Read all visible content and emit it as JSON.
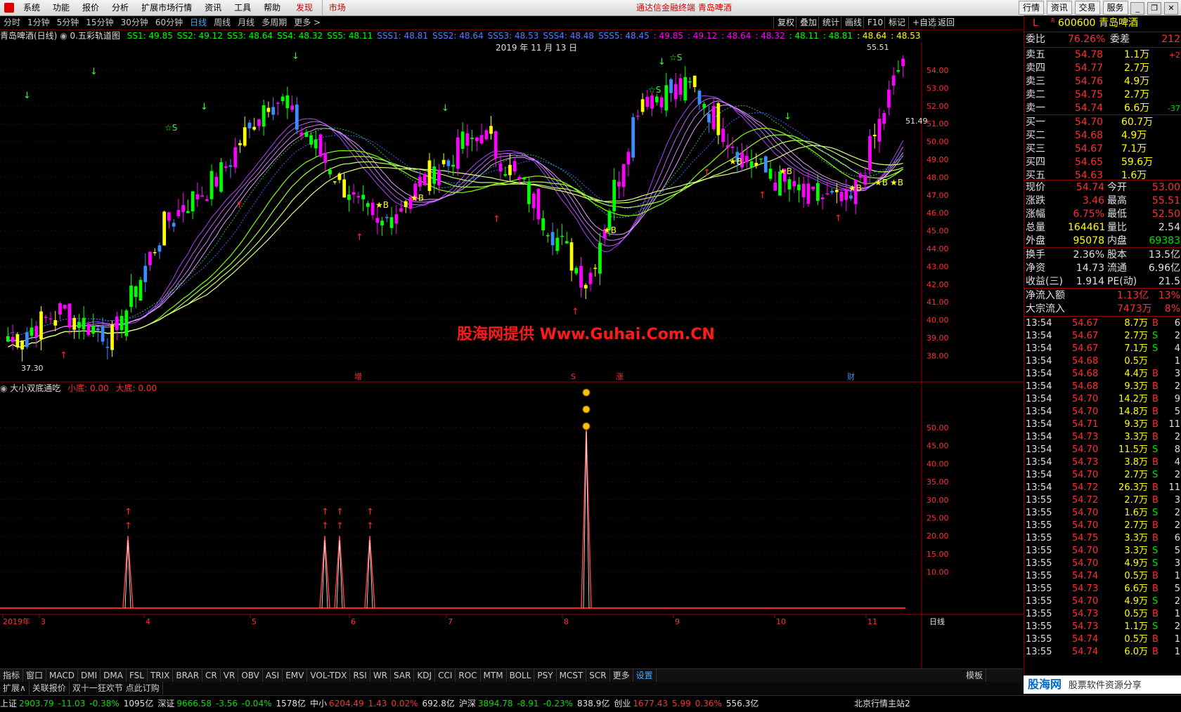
{
  "menubar": {
    "items": [
      "系统",
      "功能",
      "报价",
      "分析",
      "扩展市场行情",
      "资讯",
      "工具",
      "帮助"
    ],
    "hl1": "发现",
    "hl2": "市场",
    "title": "通达信金融终端  青岛啤酒",
    "right": [
      "行情",
      "资讯",
      "交易",
      "服务"
    ]
  },
  "periodbar": {
    "items": [
      "分时",
      "1分钟",
      "5分钟",
      "15分钟",
      "30分钟",
      "60分钟",
      "日线",
      "周线",
      "月线",
      "多周期",
      "更多 >"
    ],
    "active_index": 6,
    "right": [
      "复权",
      "叠加",
      "统计",
      "画线",
      "F10",
      "标记",
      "+自选",
      "返回"
    ]
  },
  "main_legend": {
    "title": "青岛啤酒(日线)",
    "indicator": "0.五彩轨道图",
    "items": [
      {
        "t": "SS1: 49.85",
        "c": "#00ff00"
      },
      {
        "t": "SS2: 49.12",
        "c": "#00ff00"
      },
      {
        "t": "SS3: 48.64",
        "c": "#00ff00"
      },
      {
        "t": "SS4: 48.32",
        "c": "#00ff00"
      },
      {
        "t": "SS5: 48.11",
        "c": "#00ff00"
      },
      {
        "t": "SSS1: 48.81",
        "c": "#5080ff"
      },
      {
        "t": "SSS2: 48.64",
        "c": "#5080ff"
      },
      {
        "t": "SSS3: 48.53",
        "c": "#5080ff"
      },
      {
        "t": "SSS4: 48.48",
        "c": "#5080ff"
      },
      {
        "t": "SSS5: 48.45",
        "c": "#5080ff"
      },
      {
        "t": ": 49.85",
        "c": "#ff00ff"
      },
      {
        "t": ": 49.12",
        "c": "#ff00ff"
      },
      {
        "t": ": 48.64",
        "c": "#ff00ff"
      },
      {
        "t": ": 48.32",
        "c": "#ff00ff"
      },
      {
        "t": ": 48.11",
        "c": "#00ff00"
      },
      {
        "t": ": 48.81",
        "c": "#00ff00"
      },
      {
        "t": ": 48.64",
        "c": "#ffff00"
      },
      {
        "t": ": 48.53",
        "c": "#ffff00"
      }
    ]
  },
  "chart_date": "2019 年 11 月 13 日",
  "price_axis": [
    "54.00",
    "53.00",
    "52.00",
    "51.00",
    "50.00",
    "49.00",
    "48.00",
    "47.00",
    "46.00",
    "45.00",
    "44.00",
    "43.00",
    "42.00",
    "41.00",
    "40.00",
    "39.00",
    "38.00"
  ],
  "main_labels": {
    "high": "55.51",
    "low": "37.30",
    "last": "51.49"
  },
  "event_marks": [
    {
      "t": "增"
    },
    {
      "t": "S"
    },
    {
      "t": "涨"
    },
    {
      "t": "财"
    }
  ],
  "watermark": "股海网提供 Www.Guhai.Com.CN",
  "sub_legend": {
    "title": "大小双底通吃",
    "l1": "小底: 0.00",
    "l2": "大底: 0.00"
  },
  "sub_axis": [
    "50.00",
    "45.00",
    "40.00",
    "35.00",
    "30.00",
    "25.00",
    "20.00",
    "15.00",
    "10.00"
  ],
  "time_axis": {
    "labels": [
      "2019年",
      "3",
      "4",
      "5",
      "6",
      "7",
      "8",
      "9",
      "10",
      "11"
    ],
    "right": "日线"
  },
  "indicator_tabs": [
    "指标",
    "窗口",
    "MACD",
    "DMI",
    "DMA",
    "FSL",
    "TRIX",
    "BRAR",
    "CR",
    "VR",
    "OBV",
    "ASI",
    "EMV",
    "VOL-TDX",
    "RSI",
    "WR",
    "SAR",
    "KDJ",
    "CCI",
    "ROC",
    "MTM",
    "BOLL",
    "PSY",
    "MCST",
    "SCR",
    "更多",
    "设置"
  ],
  "indicator_right": "模板",
  "ext_tabs": [
    "扩展∧",
    "关联报价",
    "双十一狂欢节 点此订购"
  ],
  "status": [
    {
      "name": "上证",
      "v": "2903.79",
      "c": "-11.03",
      "p": "-0.38%",
      "a": "1095亿"
    },
    {
      "name": "深证",
      "v": "9666.58",
      "c": "-3.56",
      "p": "-0.04%",
      "a": "1578亿"
    },
    {
      "name": "中小",
      "v": "6204.49",
      "c": "1.43",
      "p": "0.02%",
      "a": "692.8亿"
    },
    {
      "name": "沪深",
      "v": "3894.78",
      "c": "-8.91",
      "p": "-0.23%",
      "a": "838.9亿"
    },
    {
      "name": "创业",
      "v": "1677.43",
      "c": "5.99",
      "p": "0.36%",
      "a": "556.3亿"
    }
  ],
  "status_right": "北京行情主站2",
  "rpanel": {
    "header": {
      "code": "600600",
      "name": "青岛啤酒",
      "flag": "L",
      "sup": "R"
    },
    "webi": {
      "l": "委比",
      "v": "76.26%",
      "l2": "委差",
      "v2": "212"
    },
    "asks": [
      {
        "l": "卖五",
        "p": "54.78",
        "q": "1.1万",
        "d": "+2"
      },
      {
        "l": "卖四",
        "p": "54.77",
        "q": "2.7万",
        "d": ""
      },
      {
        "l": "卖三",
        "p": "54.76",
        "q": "4.9万",
        "d": ""
      },
      {
        "l": "卖二",
        "p": "54.75",
        "q": "2.7万",
        "d": ""
      },
      {
        "l": "卖一",
        "p": "54.74",
        "q": "6.6万",
        "d": "-37"
      }
    ],
    "bids": [
      {
        "l": "买一",
        "p": "54.70",
        "q": "60.7万"
      },
      {
        "l": "买二",
        "p": "54.68",
        "q": "4.9万"
      },
      {
        "l": "买三",
        "p": "54.67",
        "q": "7.1万"
      },
      {
        "l": "买四",
        "p": "54.65",
        "q": "59.6万"
      },
      {
        "l": "买五",
        "p": "54.63",
        "q": "1.6万"
      }
    ],
    "stats": [
      {
        "l1": "现价",
        "v1": "54.74",
        "l2": "今开",
        "v2": "53.00"
      },
      {
        "l1": "涨跌",
        "v1": "3.46",
        "l2": "最高",
        "v2": "55.51"
      },
      {
        "l1": "涨幅",
        "v1": "6.75%",
        "l2": "最低",
        "v2": "52.50"
      },
      {
        "l1": "总量",
        "v1": "164461",
        "l2": "量比",
        "v2": "2.54"
      },
      {
        "l1": "外盘",
        "v1": "95078",
        "l2": "内盘",
        "v2": "69383"
      }
    ],
    "stats2": [
      {
        "l1": "换手",
        "v1": "2.36%",
        "l2": "股本",
        "v2": "13.5亿"
      },
      {
        "l1": "净资",
        "v1": "14.73",
        "l2": "流通",
        "v2": "6.96亿"
      },
      {
        "l1": "收益(三)",
        "v1": "1.914",
        "l2": "PE(动)",
        "v2": "21.5"
      }
    ],
    "flow": [
      {
        "l": "净流入额",
        "v": "1.13亿",
        "p": "13%"
      },
      {
        "l": "大宗流入",
        "v": "7473万",
        "p": "8%"
      }
    ],
    "ticks": [
      [
        "13:54",
        "54.67",
        "8.7万",
        "B",
        "6"
      ],
      [
        "13:54",
        "54.67",
        "2.7万",
        "S",
        "2"
      ],
      [
        "13:54",
        "54.67",
        "7.1万",
        "S",
        "4"
      ],
      [
        "13:54",
        "54.68",
        "0.5万",
        "",
        "1"
      ],
      [
        "13:54",
        "54.68",
        "4.4万",
        "B",
        "3"
      ],
      [
        "13:54",
        "54.68",
        "9.3万",
        "B",
        "2"
      ],
      [
        "13:54",
        "54.70",
        "14.2万",
        "B",
        "9"
      ],
      [
        "13:54",
        "54.70",
        "14.8万",
        "B",
        "5"
      ],
      [
        "13:54",
        "54.71",
        "9.3万",
        "B",
        "11"
      ],
      [
        "13:54",
        "54.73",
        "3.3万",
        "B",
        "2"
      ],
      [
        "13:54",
        "54.70",
        "11.5万",
        "S",
        "8"
      ],
      [
        "13:54",
        "54.73",
        "3.8万",
        "B",
        "4"
      ],
      [
        "13:54",
        "54.70",
        "2.7万",
        "S",
        "2"
      ],
      [
        "13:54",
        "54.72",
        "26.3万",
        "B",
        "11"
      ],
      [
        "13:55",
        "54.72",
        "2.7万",
        "B",
        "3"
      ],
      [
        "13:55",
        "54.70",
        "1.6万",
        "S",
        "2"
      ],
      [
        "13:55",
        "54.70",
        "2.7万",
        "B",
        "2"
      ],
      [
        "13:55",
        "54.75",
        "3.3万",
        "B",
        "6"
      ],
      [
        "13:55",
        "54.70",
        "3.3万",
        "S",
        "5"
      ],
      [
        "13:55",
        "54.70",
        "4.9万",
        "S",
        "3"
      ],
      [
        "13:55",
        "54.74",
        "0.5万",
        "B",
        "1"
      ],
      [
        "13:55",
        "54.73",
        "6.6万",
        "B",
        "5"
      ],
      [
        "13:55",
        "54.70",
        "4.9万",
        "S",
        "2"
      ],
      [
        "13:55",
        "54.73",
        "0.5万",
        "B",
        "1"
      ],
      [
        "13:55",
        "54.73",
        "1.1万",
        "S",
        "2"
      ],
      [
        "13:55",
        "54.74",
        "0.5万",
        "B",
        "1"
      ],
      [
        "13:55",
        "54.74",
        "6.0万",
        "B",
        "1"
      ]
    ],
    "brand1": "股海网",
    "brand2": "股票软件资源分享"
  },
  "chart_data": {
    "type": "candlestick",
    "title": "青岛啤酒(日线)",
    "ylim": [
      37.3,
      55.51
    ],
    "x_months": [
      "3",
      "4",
      "5",
      "6",
      "7",
      "8",
      "9",
      "10",
      "11"
    ],
    "close_points": [
      {
        "m": "3",
        "v": 38.8
      },
      {
        "m": "3",
        "v": 40.5
      },
      {
        "m": "4",
        "v": 39.0
      },
      {
        "m": "4",
        "v": 45.5
      },
      {
        "m": "5",
        "v": 48.0
      },
      {
        "m": "5",
        "v": 52.8
      },
      {
        "m": "6",
        "v": 49.0
      },
      {
        "m": "6",
        "v": 45.0
      },
      {
        "m": "7",
        "v": 48.2
      },
      {
        "m": "7",
        "v": 50.5
      },
      {
        "m": "8",
        "v": 46.5
      },
      {
        "m": "8",
        "v": 42.0
      },
      {
        "m": "9",
        "v": 52.5
      },
      {
        "m": "9",
        "v": 53.0
      },
      {
        "m": "10",
        "v": 49.0
      },
      {
        "m": "10",
        "v": 47.0
      },
      {
        "m": "11",
        "v": 46.5
      },
      {
        "m": "11",
        "v": 54.74
      }
    ],
    "sub_series": {
      "name": "大小双底通吃",
      "ylim": [
        0,
        55
      ],
      "spikes": [
        {
          "m": "4",
          "v": 20
        },
        {
          "m": "6",
          "v": 20
        },
        {
          "m": "6",
          "v": 20
        },
        {
          "m": "6",
          "v": 20
        },
        {
          "m": "8",
          "v": 50
        }
      ]
    }
  }
}
